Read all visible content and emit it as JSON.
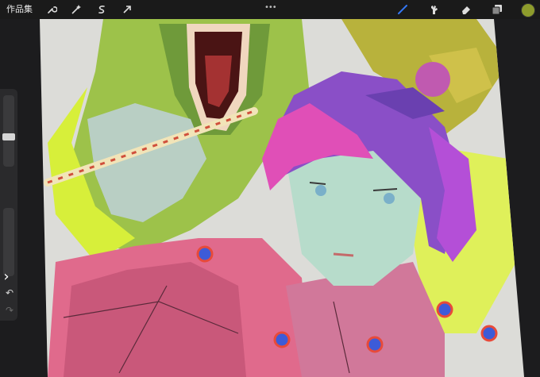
{
  "toolbar": {
    "gallery_label": "作品集",
    "left_tools": [
      "wrench-icon",
      "magic-wand-icon",
      "selection-icon",
      "transform-arrow-icon"
    ],
    "right_tools": [
      "brush-icon",
      "smudge-icon",
      "eraser-icon",
      "layers-icon"
    ],
    "more_label": "•••",
    "current_color": "#8e9c2c"
  },
  "colors": {
    "accent": "#3478f6",
    "background": "#1c1c1e"
  }
}
